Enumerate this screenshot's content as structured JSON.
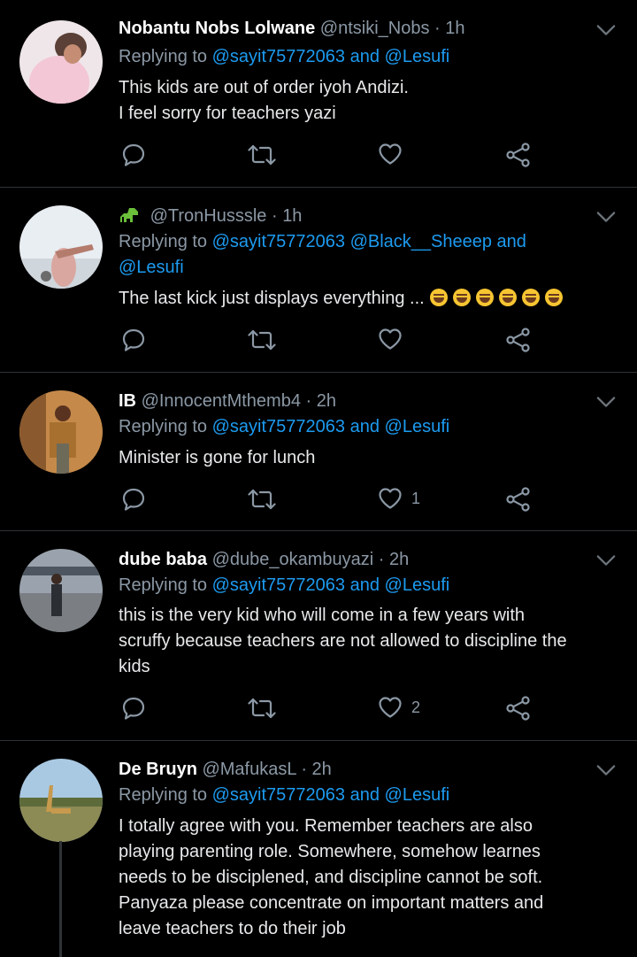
{
  "colors": {
    "background": "#000000",
    "link": "#1d9bf0",
    "muted": "#8b98a5",
    "text": "#e7e9ea"
  },
  "tweets": [
    {
      "name": "Nobantu Nobs Lolwane",
      "handle": "@ntsiki_Nobs",
      "sep": "·",
      "time": "1h",
      "replying_prefix": "Replying to",
      "replying_links": "@sayit75772063 and @Lesufi",
      "text_lines": [
        "This kids are out of order iyoh Andizi.",
        "I feel sorry for teachers yazi"
      ],
      "like_count": ""
    },
    {
      "name": "",
      "handle": "@TronHusssle",
      "sep": "·",
      "time": "1h",
      "replying_prefix": "Replying to",
      "replying_links_line1": "@sayit75772063 @Black__Sheeep and",
      "replying_links_line2": "@Lesufi",
      "text": "The last kick just displays everything ...",
      "emoji_icon": "grinning-squinting-face-emoji",
      "like_count": ""
    },
    {
      "name": "IB",
      "handle": "@InnocentMthemb4",
      "sep": "·",
      "time": "2h",
      "replying_prefix": "Replying to",
      "replying_links": "@sayit75772063 and @Lesufi",
      "text_lines": [
        "Minister is gone for lunch"
      ],
      "like_count": "1"
    },
    {
      "name": "dube baba",
      "handle": "@dube_okambuyazi",
      "sep": "·",
      "time": "2h",
      "replying_prefix": "Replying to",
      "replying_links": "@sayit75772063 and @Lesufi",
      "text_lines": [
        "this is the very kid who will come in a few years with",
        "scruffy because teachers are not allowed to discipline the",
        "kids"
      ],
      "like_count": "2"
    },
    {
      "name": "De Bruyn",
      "handle": "@MafukasL",
      "sep": "·",
      "time": "2h",
      "replying_prefix": "Replying to",
      "replying_links": "@sayit75772063 and @Lesufi",
      "text_lines": [
        "I totally agree with you. Remember teachers are also",
        "playing parenting role. Somewhere, somehow learnes",
        "needs to be disciplened, and discipline cannot be soft.",
        "Panyaza please concentrate on important matters and",
        "leave teachers to do their job"
      ]
    }
  ],
  "icons": {
    "reply": "reply-icon",
    "retweet": "retweet-icon",
    "like": "heart-icon",
    "share": "share-icon",
    "more": "chevron-down-icon"
  }
}
